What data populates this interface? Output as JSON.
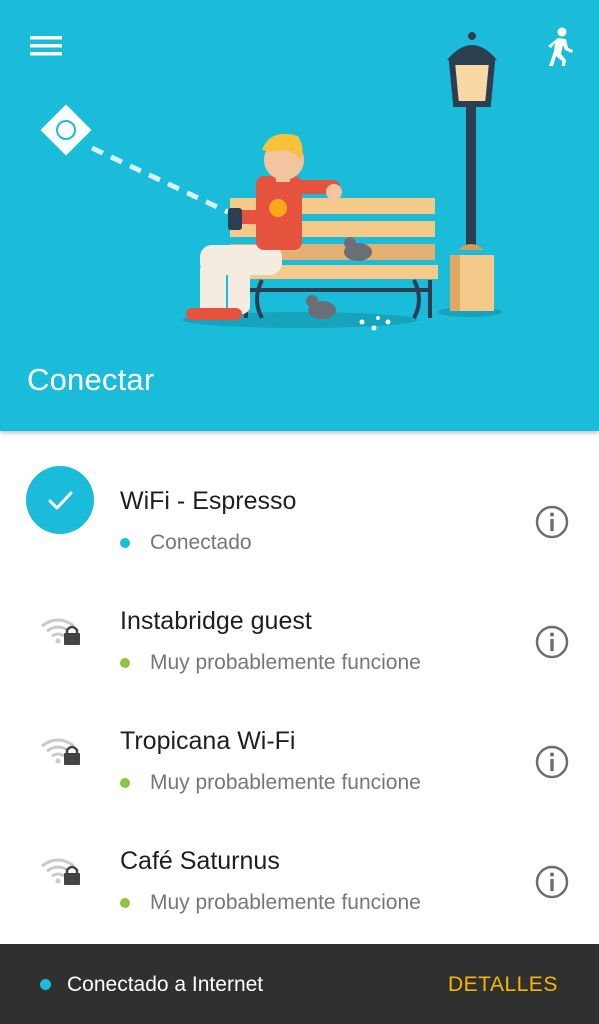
{
  "header": {
    "title": "Conectar",
    "menu_icon": "hamburger-menu-icon",
    "walk_icon": "walking-person-icon"
  },
  "colors": {
    "accent": "#1bbcd9",
    "connected_dot": "#1bbcd9",
    "likely_dot": "#8cc63f",
    "bottom_bar": "#303030",
    "details_text": "#f5b800"
  },
  "networks": [
    {
      "name": "WiFi - Espresso",
      "status": "Conectado",
      "state": "connected"
    },
    {
      "name": "Instabridge guest",
      "status": "Muy probablemente funcione",
      "state": "likely"
    },
    {
      "name": "Tropicana Wi-Fi",
      "status": "Muy probablemente funcione",
      "state": "likely"
    },
    {
      "name": "Café Saturnus",
      "status": "Muy probablemente funcione",
      "state": "likely"
    }
  ],
  "bottom": {
    "status_text": "Conectado a Internet",
    "details_label": "DETALLES"
  }
}
